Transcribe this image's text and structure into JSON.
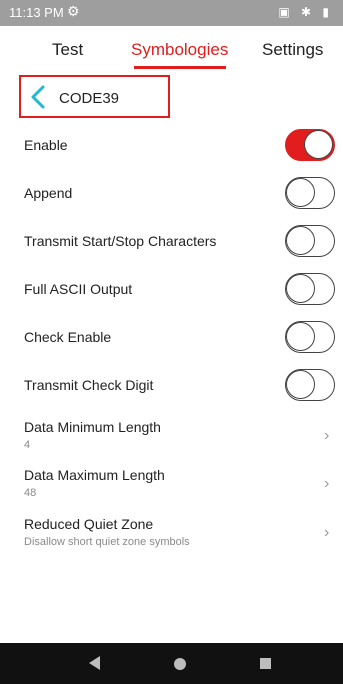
{
  "status_bar": {
    "time": "11:13 PM",
    "left_icon": "gear-icon",
    "right_icons": "▣ ✱ ▮"
  },
  "tabs": [
    {
      "label": "Test",
      "active": false
    },
    {
      "label": "Symbologies",
      "active": true
    },
    {
      "label": "Settings",
      "active": false
    }
  ],
  "header": {
    "back_icon": "chevron-left-icon",
    "title": "CODE39"
  },
  "toggles": [
    {
      "label": "Enable",
      "on": true
    },
    {
      "label": "Append",
      "on": false
    },
    {
      "label": "Transmit Start/Stop Characters",
      "on": false
    },
    {
      "label": "Full ASCII Output",
      "on": false
    },
    {
      "label": "Check Enable",
      "on": false
    },
    {
      "label": "Transmit Check Digit",
      "on": false
    }
  ],
  "settings": [
    {
      "label": "Data Minimum Length",
      "value": "4",
      "chevron": "›"
    },
    {
      "label": "Data Maximum Length",
      "value": "48",
      "chevron": "›"
    },
    {
      "label": "Reduced Quiet Zone",
      "value": "Disallow short quiet zone symbols",
      "chevron": "›"
    }
  ],
  "colors": {
    "accent": "#e11d1d",
    "status_bar": "#9e9e9e",
    "nav_bar": "#111111"
  },
  "nav_bar": {
    "back_icon": "nav-back-icon",
    "home_icon": "nav-home-icon",
    "recent_icon": "nav-recent-icon"
  }
}
